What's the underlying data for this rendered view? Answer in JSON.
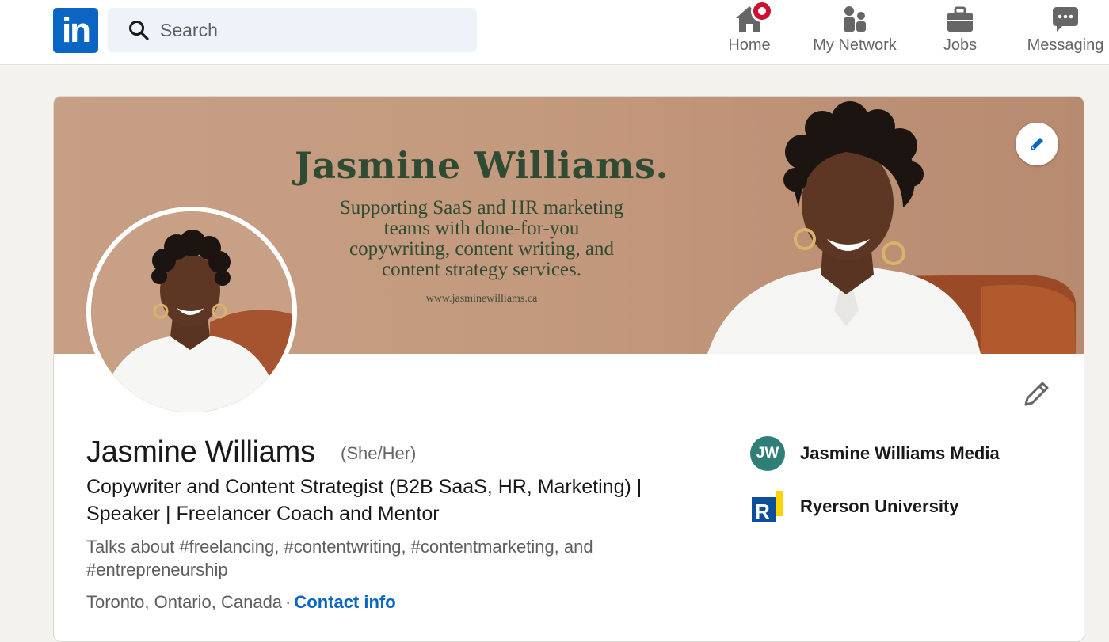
{
  "nav": {
    "logo_text": "in",
    "search_placeholder": "Search",
    "items": [
      {
        "label": "Home",
        "icon": "home-icon"
      },
      {
        "label": "My Network",
        "icon": "network-icon"
      },
      {
        "label": "Jobs",
        "icon": "briefcase-icon"
      },
      {
        "label": "Messaging",
        "icon": "chat-icon"
      }
    ]
  },
  "banner": {
    "title": "Jasmine Williams.",
    "tagline_lines": [
      "Supporting SaaS and HR marketing",
      "teams with done-for-you",
      "copywriting, content writing, and",
      "content strategy services."
    ],
    "url": "www.jasminewilliams.ca"
  },
  "profile": {
    "name": "Jasmine Williams",
    "pronouns": "(She/Her)",
    "headline_line1": "Copywriter and Content Strategist (B2B SaaS, HR, Marketing) |",
    "headline_line2": "Speaker | Freelancer Coach and Mentor",
    "talks_line1": "Talks about #freelancing, #contentwriting, #contentmarketing, and",
    "talks_line2": "#entrepreneurship",
    "location": "Toronto, Ontario, Canada",
    "separator": "·",
    "contact_label": "Contact info"
  },
  "organizations": [
    {
      "label": "Jasmine Williams Media",
      "logo_text": "JW"
    },
    {
      "label": "Ryerson University",
      "logo_text": "R"
    }
  ],
  "colors": {
    "brand": "#0a66c2",
    "badge": "#cb112d",
    "banner_text": "#2f4b34",
    "jw_logo": "#2f7f78"
  }
}
